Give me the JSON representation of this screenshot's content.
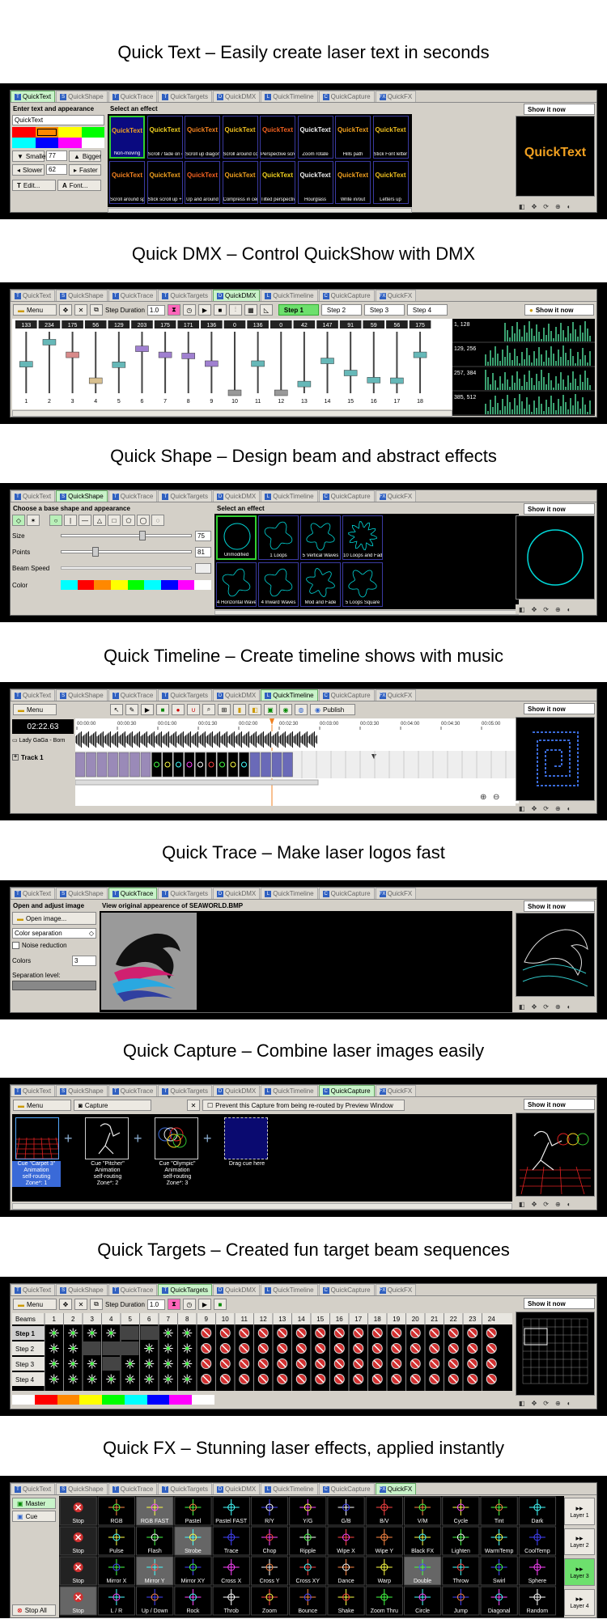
{
  "tabs": [
    "QuickText",
    "QuickShape",
    "QuickTrace",
    "QuickTargets",
    "QuickDMX",
    "QuickTimeline",
    "QuickCapture",
    "QuickFX"
  ],
  "tab_icons": {
    "QuickText": "T",
    "QuickShape": "S",
    "QuickTrace": "T",
    "QuickTargets": "T",
    "QuickDMX": "D",
    "QuickTimeline": "L",
    "QuickCapture": "C",
    "QuickFX": "FX"
  },
  "common": {
    "show_it_now": "Show it now",
    "menu": "Menu"
  },
  "sections": {
    "text": {
      "heading": "Quick Text – Easily create laser text in seconds",
      "panel_title": "Enter text and appearance",
      "input_value": "QuickText",
      "effect_title": "Select an effect",
      "smaller": "Smaller",
      "bigger": "Bigger",
      "size_value": "77",
      "slower": "Slower",
      "faster": "Faster",
      "speed_value": "62",
      "edit": "Edit...",
      "font": "Font...",
      "effects": [
        "Non-moving",
        "Scroll / fade on ends",
        "Scroll up diagonally",
        "Scroll around cone",
        "Perspective scroll",
        "Zoom rotate",
        "Hills path",
        "Stick Font letter zoom",
        "Scroll around sphere",
        "Stick scroll up + down",
        "Up and around",
        "Compress in center",
        "Tilted perspective",
        "Hourglass",
        "Write in/out",
        "Letters up"
      ],
      "preview_text": "QuickText",
      "colors": [
        "#ff0000",
        "#ff8800",
        "#ffff00",
        "#00ff00",
        "#00ffff",
        "#0000ff",
        "#ff00ff",
        "#ffffff"
      ]
    },
    "dmx": {
      "heading": "Quick DMX – Control QuickShow with DMX",
      "step_duration": "Step Duration",
      "step_value": "1.0",
      "steps": [
        "Step 1",
        "Step 2",
        "Step 3",
        "Step 4"
      ],
      "values": [
        "133",
        "234",
        "175",
        "56",
        "129",
        "203",
        "175",
        "171",
        "136",
        "0",
        "136",
        "0",
        "42",
        "147",
        "91",
        "59",
        "56",
        "175"
      ],
      "channels": [
        "1",
        "2",
        "3",
        "4",
        "5",
        "6",
        "7",
        "8",
        "9",
        "10",
        "11",
        "12",
        "13",
        "14",
        "15",
        "16",
        "17",
        "18"
      ],
      "levels": [
        0.52,
        0.92,
        0.69,
        0.22,
        0.51,
        0.8,
        0.69,
        0.67,
        0.53,
        0.0,
        0.53,
        0.0,
        0.16,
        0.58,
        0.36,
        0.23,
        0.22,
        0.69
      ],
      "monitor": [
        "1, 128",
        "129, 256",
        "257, 384",
        "385, 512"
      ]
    },
    "shape": {
      "heading": "Quick Shape – Design beam and abstract effects",
      "panel_title": "Choose a base shape and appearance",
      "effect_title": "Select an effect",
      "size_label": "Size",
      "size_value": "75",
      "points_label": "Points",
      "points_value": "81",
      "beam_label": "Beam Speed",
      "color_label": "Color",
      "effects": [
        "Unmodified",
        "1 Loops",
        "5 Vertical Waves",
        "10 Loops and Fade",
        "4 Horizontal Waves",
        "4 Inward Waves",
        "Mod and Fade",
        "5 Loops Square"
      ],
      "colors": [
        "#00ffff",
        "#ff0000",
        "#ff8800",
        "#ffff00",
        "#00ff00",
        "#00ffff",
        "#0000ff",
        "#ff00ff",
        "#ffffff"
      ]
    },
    "timeline": {
      "heading": "Quick Timeline – Create timeline shows with music",
      "publish": "Publish",
      "time": "02:22.63",
      "audio_track": "Lady GaGa - Born",
      "track1": "Track 1",
      "ruler": [
        "00:00:00",
        "00:00:30",
        "00:01:00",
        "00:01:30",
        "00:02:00",
        "00:02:30",
        "00:03:00",
        "00:03:30",
        "00:04:00",
        "00:04:30",
        "00:05:00"
      ]
    },
    "trace": {
      "heading": "Quick Trace – Make laser logos fast",
      "panel_title": "Open and adjust image",
      "view_title": "View original appearence of SEAWORLD.BMP",
      "open_image": "Open image...",
      "color_sep": "Color separation",
      "noise": "Noise reduction",
      "colors_label": "Colors",
      "colors_value": "3",
      "sep_level": "Separation level:"
    },
    "capture": {
      "heading": "Quick Capture – Combine laser images easily",
      "capture": "Capture",
      "prevent": "Prevent this Capture from being re-routed by Preview Window",
      "cues": [
        {
          "title": "Cue \"Carpet 3\"",
          "l2": "Animation",
          "l3": "self-routing",
          "l4": "Zone*: 1"
        },
        {
          "title": "Cue \"Pitcher\"",
          "l2": "Animation",
          "l3": "self-routing",
          "l4": "Zone*: 2"
        },
        {
          "title": "Cue \"Olympic\"",
          "l2": "Animation",
          "l3": "self-routing",
          "l4": "Zone*: 3"
        }
      ],
      "drag": "Drag cue here"
    },
    "targets": {
      "heading": "Quick Targets – Created fun target beam sequences",
      "step_duration": "Step Duration",
      "step_value": "1.0",
      "beams": "Beams",
      "beam_numbers": [
        "1",
        "2",
        "3",
        "4",
        "5",
        "6",
        "7",
        "8",
        "9",
        "10",
        "11",
        "12",
        "13",
        "14",
        "15",
        "16",
        "17",
        "18",
        "19",
        "20",
        "21",
        "22",
        "23",
        "24"
      ],
      "steps": [
        "Step 1",
        "Step 2",
        "Step 3",
        "Step 4"
      ],
      "colors": [
        "#ffffff",
        "#ff0000",
        "#ff8800",
        "#ffff00",
        "#00ff00",
        "#00ffff",
        "#0000ff",
        "#ff00ff",
        "#ffffff"
      ]
    },
    "fx": {
      "heading": "Quick FX – Stunning laser effects, applied instantly",
      "master": "Master",
      "cue": "Cue",
      "stop_all": "Stop All",
      "rows": [
        [
          "Stop",
          "RGB",
          "RGB FAST",
          "Pastel",
          "Pastel FAST",
          "R/Y",
          "Y/G",
          "G/B",
          "B/V",
          "V/M",
          "Cycle",
          "Tint",
          "Dark"
        ],
        [
          "Stop",
          "Pulse",
          "Flash",
          "Strobe",
          "Trace",
          "Chop",
          "Ripple",
          "Wipe X",
          "Wipe Y",
          "Black FX",
          "Lighten",
          "WarmTemp",
          "CoolTemp"
        ],
        [
          "Stop",
          "Mirror X",
          "Mirror Y",
          "Mirror XY",
          "Cross X",
          "Cross Y",
          "Cross XY",
          "Dance",
          "Warp",
          "Double",
          "Throw",
          "Swirl",
          "Sphere"
        ],
        [
          "Stop",
          "L / R",
          "Up / Down",
          "Rock",
          "Throb",
          "Zoom",
          "Bounce",
          "Shake",
          "Zoom Thru",
          "Circle",
          "Jump",
          "Diagonal",
          "Random"
        ]
      ],
      "layers": [
        "Layer 1",
        "Layer 2",
        "Layer 3",
        "Layer 4"
      ]
    }
  }
}
